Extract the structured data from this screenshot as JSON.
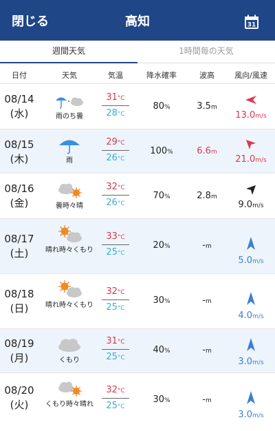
{
  "header": {
    "close_label": "閉じる",
    "title": "高知",
    "calendar_day": "31"
  },
  "tabs": [
    {
      "label": "週間天気",
      "active": true
    },
    {
      "label": "1時間毎の天気",
      "active": false
    }
  ],
  "columns": {
    "date": "日付",
    "weather": "天気",
    "temp": "気温",
    "rain": "降水確率",
    "wave": "波高",
    "wind": "風向/風速"
  },
  "units": {
    "temp": "°C",
    "rain": "%",
    "wave": "m",
    "wind": "m/s"
  },
  "colors": {
    "header": "#1f4686",
    "high_temp": "#d9394c",
    "low_temp": "#37b0cf",
    "alert": "#d9394c",
    "wind_blue": "#3a7fd6"
  },
  "days": [
    {
      "date": "08/14",
      "dow": "(水)",
      "weather": "雨のち曇",
      "icon": "rain-then-cloud-icon",
      "high": "31",
      "low": "28",
      "rain": "80",
      "wave": "3.5",
      "wind": "13.0",
      "wind_dir": "west",
      "wind_color": "red"
    },
    {
      "date": "08/15",
      "dow": "(木)",
      "weather": "雨",
      "icon": "umbrella-icon",
      "high": "29",
      "low": "26",
      "rain": "100",
      "wave": "6.6",
      "wind": "21.0",
      "wind_dir": "north-west",
      "wind_color": "red"
    },
    {
      "date": "08/16",
      "dow": "(金)",
      "weather": "曇時々晴",
      "icon": "cloud-sometimes-sun-icon",
      "high": "32",
      "low": "26",
      "rain": "70",
      "wave": "2.8",
      "wind": "9.0",
      "wind_dir": "north-east",
      "wind_color": "black"
    },
    {
      "date": "08/17",
      "dow": "(土)",
      "weather": "晴れ時々くもり",
      "icon": "sun-sometimes-cloud-icon",
      "high": "33",
      "low": "25",
      "rain": "20",
      "wave": "-",
      "wind": "5.0",
      "wind_dir": "north",
      "wind_color": "blue"
    },
    {
      "date": "08/18",
      "dow": "(日)",
      "weather": "晴れ時々くもり",
      "icon": "sun-sometimes-cloud-icon",
      "high": "32",
      "low": "25",
      "rain": "30",
      "wave": "-",
      "wind": "4.0",
      "wind_dir": "north",
      "wind_color": "blue"
    },
    {
      "date": "08/19",
      "dow": "(月)",
      "weather": "くもり",
      "icon": "cloud-icon",
      "high": "31",
      "low": "25",
      "rain": "40",
      "wave": "-",
      "wind": "3.0",
      "wind_dir": "north",
      "wind_color": "blue"
    },
    {
      "date": "08/20",
      "dow": "(火)",
      "weather": "くもり時々晴れ",
      "icon": "cloud-sometimes-sun-icon",
      "high": "32",
      "low": "25",
      "rain": "30",
      "wave": "-",
      "wind": "3.0",
      "wind_dir": "north",
      "wind_color": "blue"
    }
  ]
}
